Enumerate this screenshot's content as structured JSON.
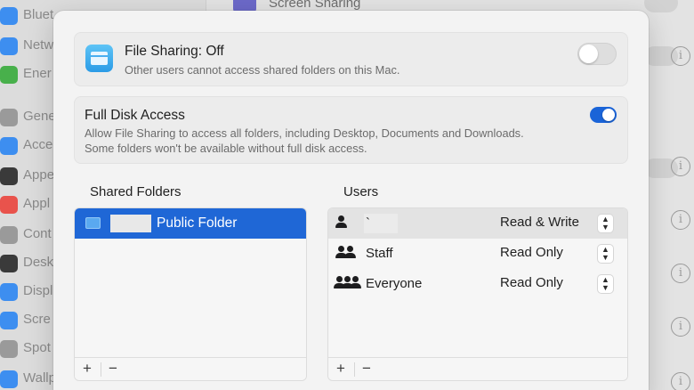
{
  "background": {
    "sidebar_items": [
      {
        "label": "Bluet",
        "color": "#3d8ef0"
      },
      {
        "label": "Netw",
        "color": "#3d8ef0"
      },
      {
        "label": "Ener",
        "color": "#48b04b"
      },
      {
        "label": "Gene",
        "color": "#8a8a8a"
      },
      {
        "label": "Acce",
        "color": "#3d8ef0"
      },
      {
        "label": "Appe",
        "color": "#2b2b2b"
      },
      {
        "label": "Appl",
        "color": "#e9534c"
      },
      {
        "label": "Cont",
        "color": "#8a8a8a"
      },
      {
        "label": "Desk",
        "color": "#2b2b2b"
      },
      {
        "label": "Displ",
        "color": "#3d8ef0"
      },
      {
        "label": "Scre",
        "color": "#3d8ef0"
      },
      {
        "label": "Spot",
        "color": "#8a8a8a"
      },
      {
        "label": "Wallp",
        "color": "#3d8ef0"
      }
    ],
    "main_item": "Screen Sharing",
    "info_icon": "i"
  },
  "file_sharing": {
    "icon": "folder-icon",
    "title": "File Sharing: Off",
    "subtitle": "Other users cannot access shared folders on this Mac.",
    "enabled": false
  },
  "full_disk_access": {
    "title": "Full Disk Access",
    "line1": "Allow File Sharing to access all folders, including Desktop, Documents and Downloads.",
    "line2": "Some folders won't be available without full disk access.",
    "enabled": true
  },
  "shared_folders": {
    "title": "Shared Folders",
    "items": [
      {
        "name": "Public Folder",
        "selected": true
      }
    ],
    "add_label": "+",
    "remove_label": "−"
  },
  "users": {
    "title": "Users",
    "rows": [
      {
        "name": "`",
        "permission": "Read & Write",
        "icon": "person-icon"
      },
      {
        "name": "Staff",
        "permission": "Read Only",
        "icon": "group-icon"
      },
      {
        "name": "Everyone",
        "permission": "Read Only",
        "icon": "everyone-icon"
      }
    ],
    "stepper_up": "▲",
    "stepper_down": "▼",
    "add_label": "+",
    "remove_label": "−"
  },
  "colors": {
    "accent": "#1f67d6",
    "toggle_on": "#1a64d8"
  }
}
